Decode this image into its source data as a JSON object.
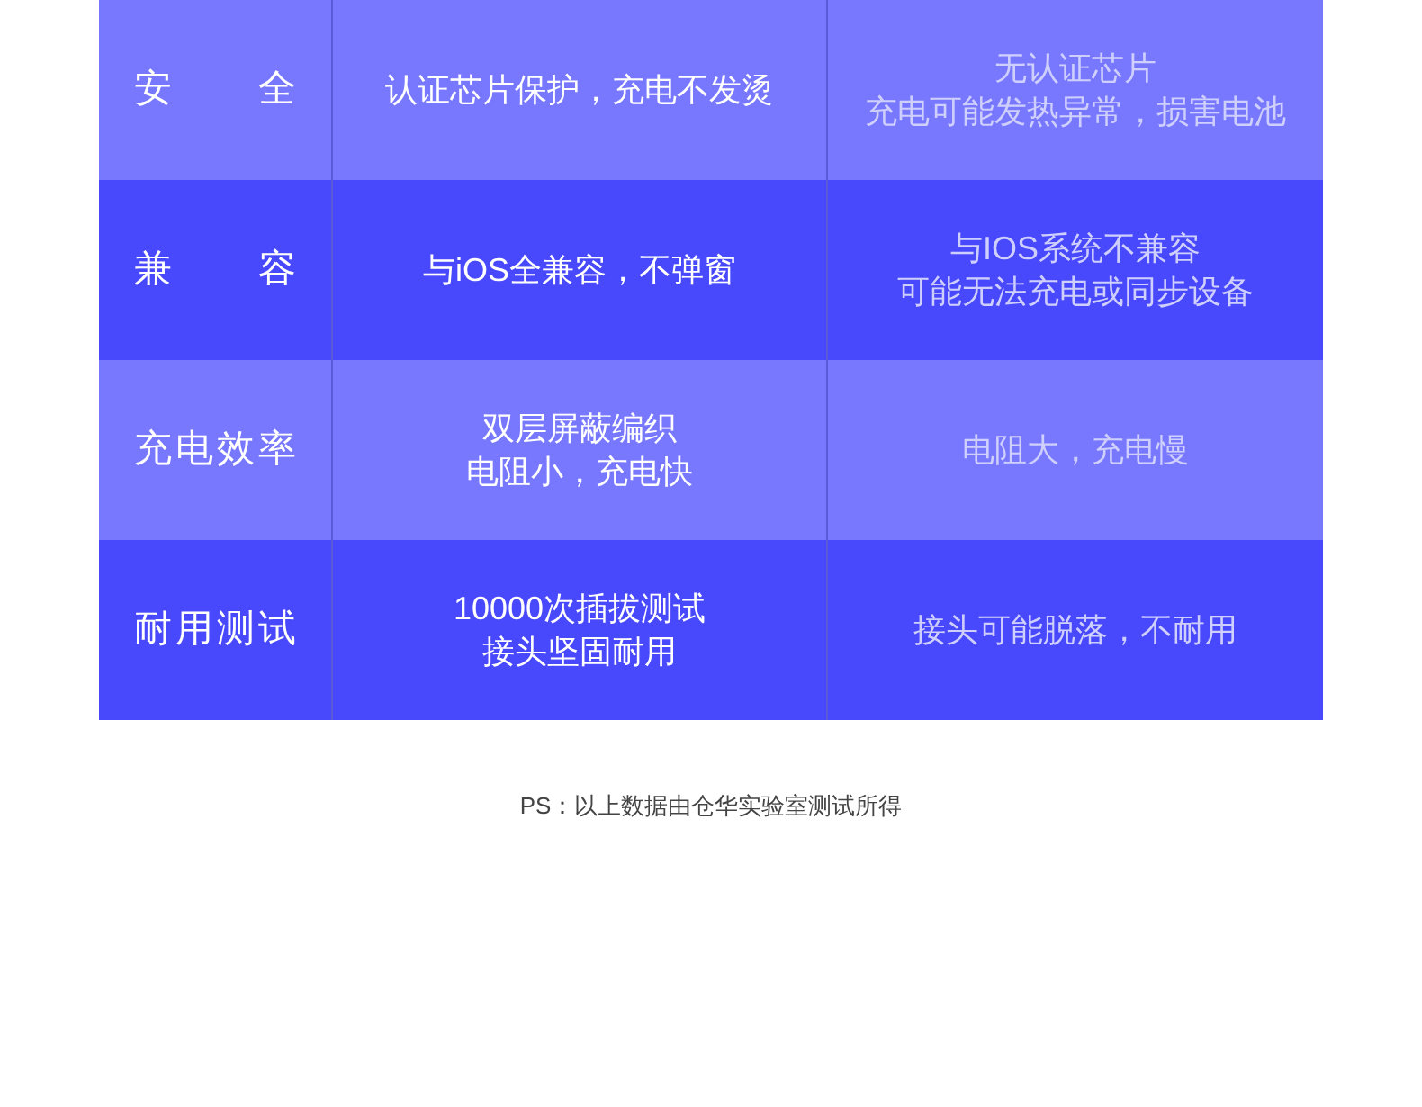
{
  "table": {
    "rows": [
      {
        "feature": "安　全",
        "ours": [
          "认证芯片保护，充电不发烫"
        ],
        "others": [
          "无认证芯片",
          "充电可能发热异常，损害电池"
        ]
      },
      {
        "feature": "兼　容",
        "ours": [
          "与iOS全兼容，不弹窗"
        ],
        "others": [
          "与IOS系统不兼容",
          "可能无法充电或同步设备"
        ]
      },
      {
        "feature": "充电效率",
        "ours": [
          "双层屏蔽编织",
          "电阻小，充电快"
        ],
        "others": [
          "电阻大，充电慢"
        ]
      },
      {
        "feature": "耐用测试",
        "ours": [
          "10000次插拔测试",
          "接头坚固耐用"
        ],
        "others": [
          "接头可能脱落，不耐用"
        ]
      }
    ]
  },
  "footnote": "PS：以上数据由仓华实验室测试所得"
}
